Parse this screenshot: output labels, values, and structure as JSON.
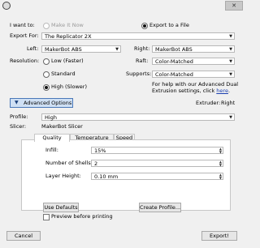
{
  "window": {
    "close_glyph": "✕",
    "app_icon": "makerbot-icon"
  },
  "want_to": {
    "label": "I want to:",
    "make_it_now": "Make It Now",
    "export_to_file": "Export to a File",
    "selected": "export_to_file"
  },
  "export_for": {
    "label": "Export For:",
    "value": "The Replicator 2X"
  },
  "extruders": {
    "left_label": "Left:",
    "left_value": "MakerBot ABS",
    "right_label": "Right:",
    "right_value": "MakerBot ABS"
  },
  "resolution": {
    "label": "Resolution:",
    "low": "Low (Faster)",
    "standard": "Standard",
    "high": "High (Slower)",
    "selected": "high"
  },
  "raft": {
    "label": "Raft:",
    "value": "Color-Matched"
  },
  "supports": {
    "label": "Supports:",
    "value": "Color-Matched"
  },
  "help": {
    "text": "For help with our Advanced Dual Extrusion settings, click ",
    "link": "here",
    "end": "."
  },
  "advanced": {
    "label": "Advanced Options",
    "extruder_label": "Extruder:",
    "extruder_value": "Right"
  },
  "profile": {
    "label": "Profile:",
    "value": "High"
  },
  "slicer": {
    "label": "Slicer:",
    "value": "MakerBot Slicer"
  },
  "tabs": [
    {
      "label": "Quality"
    },
    {
      "label": "Temperature"
    },
    {
      "label": "Speed"
    }
  ],
  "quality": {
    "infill_label": "Infill:",
    "infill_value": "15%",
    "shells_label": "Number of Shells:",
    "shells_value": "2",
    "layer_label": "Layer Height:",
    "layer_value": "0.10 mm"
  },
  "buttons": {
    "use_defaults": "Use Defaults",
    "create_profile": "Create Profile...",
    "cancel": "Cancel",
    "export": "Export!"
  },
  "preview": {
    "label": "Preview before printing",
    "checked": false
  }
}
